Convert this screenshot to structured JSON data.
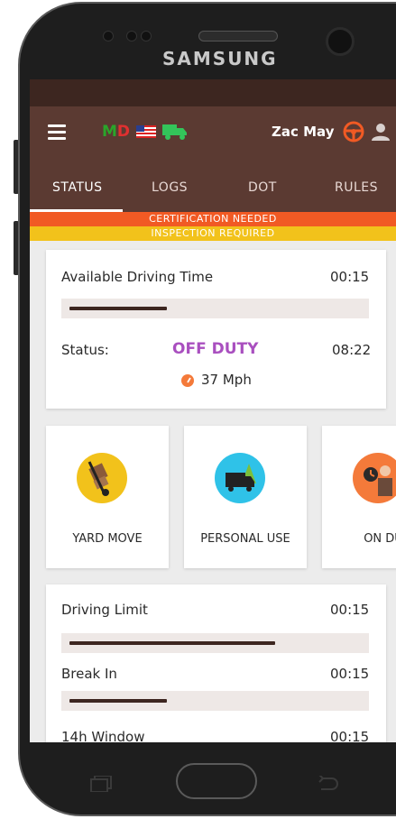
{
  "device": {
    "brand": "SAMSUNG"
  },
  "appbar": {
    "logo_m": "M",
    "logo_d": "D",
    "user_name": "Zac May"
  },
  "tabs": [
    {
      "label": "STATUS"
    },
    {
      "label": "LOGS"
    },
    {
      "label": "DOT"
    },
    {
      "label": "RULES"
    }
  ],
  "alerts": {
    "certification": "CERTIFICATION NEEDED",
    "inspection": "INSPECTION REQUIRED"
  },
  "driving_card": {
    "available_label": "Available Driving Time",
    "available_value": "00:15",
    "available_progress": 0.32,
    "status_label": "Status:",
    "status_value": "OFF DUTY",
    "status_time": "08:22",
    "speed": "37 Mph"
  },
  "actions": [
    {
      "label": "YARD MOVE",
      "icon": "hand-truck-icon",
      "color": "#f2c21b"
    },
    {
      "label": "PERSONAL USE",
      "icon": "truck-tree-icon",
      "color": "#2fc2e8"
    },
    {
      "label": "ON DU",
      "icon": "clock-person-icon",
      "color": "#f47a3a"
    }
  ],
  "limits": [
    {
      "label": "Driving Limit",
      "value": "00:15",
      "progress": 0.72
    },
    {
      "label": "Break In",
      "value": "00:15",
      "progress": 0.32
    },
    {
      "label": "14h Window",
      "value": "00:15"
    }
  ],
  "colors": {
    "header": "#5b3a32",
    "statusbar": "#3d2620",
    "alert1": "#f15a24",
    "alert2": "#f2c21b",
    "off_duty": "#a94fbf"
  }
}
